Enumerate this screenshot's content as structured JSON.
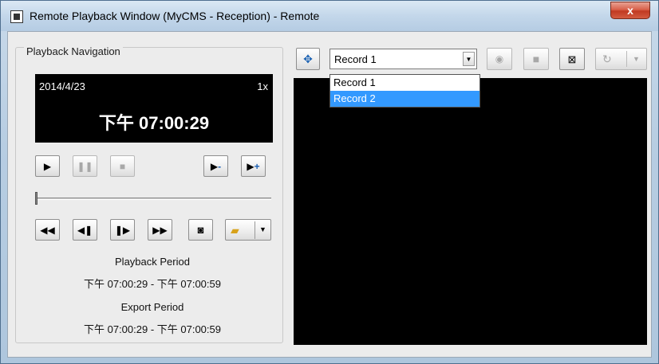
{
  "window": {
    "title": "Remote Playback Window (MyCMS - Reception) - Remote",
    "close_label": "x"
  },
  "navigation": {
    "group_label": "Playback Navigation",
    "display": {
      "date": "2014/4/23",
      "speed": "1x",
      "time": "下午 07:00:29"
    },
    "controls_row1": [
      {
        "name": "play-icon",
        "glyph": "▶",
        "enabled": true
      },
      {
        "name": "pause-icon",
        "glyph": "❚❚",
        "enabled": false
      },
      {
        "name": "stop-icon",
        "glyph": "■",
        "enabled": false
      },
      {
        "name": "speed-down-icon",
        "glyph": "▶-",
        "enabled": true
      },
      {
        "name": "speed-up-icon",
        "glyph": "▶+",
        "enabled": true
      }
    ],
    "controls_row2": [
      {
        "name": "fast-rewind-icon",
        "glyph": "◀◀",
        "enabled": true
      },
      {
        "name": "step-back-icon",
        "glyph": "◀❚",
        "enabled": true
      },
      {
        "name": "step-forward-icon",
        "glyph": "❚▶",
        "enabled": true
      },
      {
        "name": "fast-forward-icon",
        "glyph": "▶▶",
        "enabled": true
      },
      {
        "name": "snapshot-icon",
        "glyph": "📷",
        "enabled": true
      },
      {
        "name": "export-icon",
        "glyph": "📂",
        "enabled": true
      }
    ],
    "slider_position": 0.0,
    "playback_period": {
      "label": "Playback Period",
      "value": "下午 07:00:29 - 下午 07:00:59"
    },
    "export_period": {
      "label": "Export Period",
      "value": "下午 07:00:29 - 下午 07:00:59"
    }
  },
  "toolbar": {
    "record_select": {
      "value": "Record 1",
      "options": [
        "Record 1",
        "Record 2"
      ],
      "highlighted": "Record 2"
    },
    "icons": [
      "fullscreen-icon",
      "ptz-icon",
      "stop-record-icon",
      "camera-off-icon",
      "refresh-icon"
    ]
  },
  "colors": {
    "accent": "#3399ff",
    "view_bg": "#000000"
  }
}
